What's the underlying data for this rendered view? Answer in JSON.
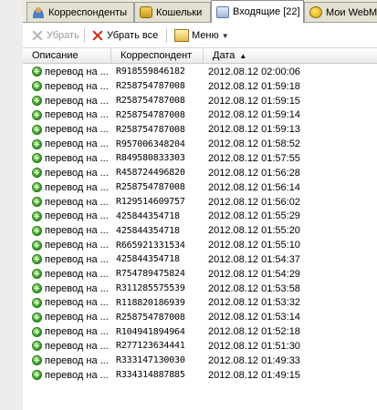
{
  "tabs": [
    {
      "label": "Корреспонденты",
      "icon": "contacts-icon",
      "active": false
    },
    {
      "label": "Кошельки",
      "icon": "wallet-icon",
      "active": false
    },
    {
      "label": "Входящие [22]",
      "icon": "inbox-icon",
      "active": true
    },
    {
      "label": "Мои WebM",
      "icon": "webmoney-icon",
      "active": false
    }
  ],
  "toolbar": {
    "remove_label": "Убрать",
    "remove_all_label": "Убрать все",
    "menu_label": "Меню"
  },
  "columns": {
    "description": "Описание",
    "correspondent": "Корреспондент",
    "date": "Дата"
  },
  "rows": [
    {
      "desc": "перевод на ...",
      "corr": "R918559846182",
      "date": "2012.08.12 02:00:06"
    },
    {
      "desc": "перевод на ...",
      "corr": "R258754787008",
      "date": "2012.08.12 01:59:18"
    },
    {
      "desc": "перевод на ...",
      "corr": "R258754787008",
      "date": "2012.08.12 01:59:15"
    },
    {
      "desc": "перевод на ...",
      "corr": "R258754787008",
      "date": "2012.08.12 01:59:14"
    },
    {
      "desc": "перевод на ...",
      "corr": "R258754787008",
      "date": "2012.08.12 01:59:13"
    },
    {
      "desc": "перевод на ...",
      "corr": "R957006348204",
      "date": "2012.08.12 01:58:52"
    },
    {
      "desc": "перевод на ...",
      "corr": "R849580833303",
      "date": "2012.08.12 01:57:55"
    },
    {
      "desc": "перевод на ...",
      "corr": "R458724496820",
      "date": "2012.08.12 01:56:28"
    },
    {
      "desc": "перевод на ...",
      "corr": "R258754787008",
      "date": "2012.08.12 01:56:14"
    },
    {
      "desc": "перевод на ...",
      "corr": "R129514609757",
      "date": "2012.08.12 01:56:02"
    },
    {
      "desc": "перевод на ...",
      "corr": "425844354718",
      "date": "2012.08.12 01:55:29"
    },
    {
      "desc": "перевод на ...",
      "corr": "425844354718",
      "date": "2012.08.12 01:55:20"
    },
    {
      "desc": "перевод на ...",
      "corr": "R665921331534",
      "date": "2012.08.12 01:55:10"
    },
    {
      "desc": "перевод на ...",
      "corr": "425844354718",
      "date": "2012.08.12 01:54:37"
    },
    {
      "desc": "перевод на ...",
      "corr": "R754789475824",
      "date": "2012.08.12 01:54:29"
    },
    {
      "desc": "перевод на ...",
      "corr": "R311285575539",
      "date": "2012.08.12 01:53:58"
    },
    {
      "desc": "перевод на ...",
      "corr": "R118820186939",
      "date": "2012.08.12 01:53:32"
    },
    {
      "desc": "перевод на ...",
      "corr": "R258754787008",
      "date": "2012.08.12 01:53:14"
    },
    {
      "desc": "перевод на ...",
      "corr": "R104941894964",
      "date": "2012.08.12 01:52:18"
    },
    {
      "desc": "перевод на ...",
      "corr": "R277123634441",
      "date": "2012.08.12 01:51:30"
    },
    {
      "desc": "перевод на ...",
      "corr": "R333147130030",
      "date": "2012.08.12 01:49:33"
    },
    {
      "desc": "перевод на ...",
      "corr": "R334314887885",
      "date": "2012.08.12 01:49:15"
    }
  ]
}
